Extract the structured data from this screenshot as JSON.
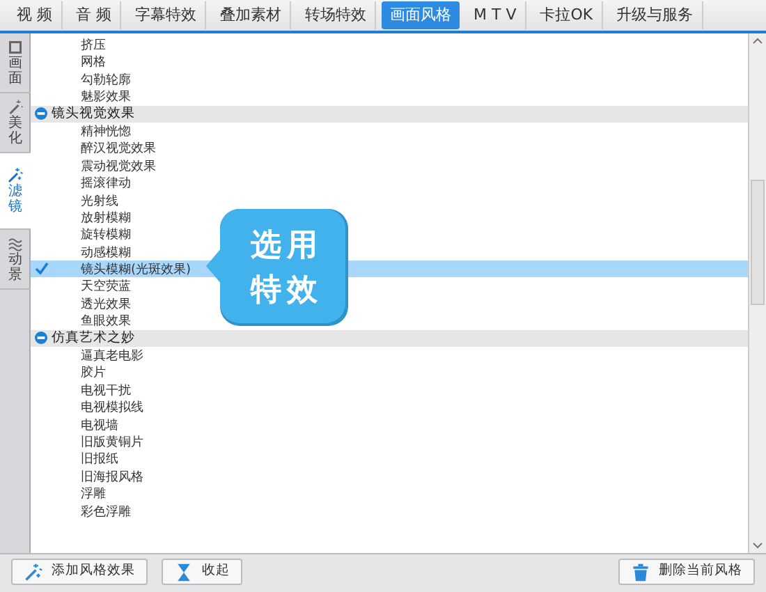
{
  "tabs": [
    {
      "label": "视 频",
      "selected": false
    },
    {
      "label": "音 频",
      "selected": false
    },
    {
      "label": "字幕特效",
      "selected": false
    },
    {
      "label": "叠加素材",
      "selected": false
    },
    {
      "label": "转场特效",
      "selected": false
    },
    {
      "label": "画面风格",
      "selected": true
    },
    {
      "label": "M T V",
      "selected": false
    },
    {
      "label": "卡拉OK",
      "selected": false
    },
    {
      "label": "升级与服务",
      "selected": false
    }
  ],
  "sidebar": {
    "items": [
      {
        "label": "画面",
        "selected": false
      },
      {
        "label": "美化",
        "selected": false
      },
      {
        "label": "滤镜",
        "selected": true
      },
      {
        "label": "动景",
        "selected": false
      }
    ]
  },
  "effects": [
    {
      "kind": "item",
      "label": "挤压",
      "selected": false
    },
    {
      "kind": "item",
      "label": "网格",
      "selected": false
    },
    {
      "kind": "item",
      "label": "勾勒轮廓",
      "selected": false
    },
    {
      "kind": "item",
      "label": "魅影效果",
      "selected": false
    },
    {
      "kind": "group",
      "label": "镜头视觉效果",
      "expanded": true
    },
    {
      "kind": "item",
      "label": "精神恍惚",
      "selected": false
    },
    {
      "kind": "item",
      "label": "醉汉视觉效果",
      "selected": false
    },
    {
      "kind": "item",
      "label": "震动视觉效果",
      "selected": false
    },
    {
      "kind": "item",
      "label": "摇滚律动",
      "selected": false
    },
    {
      "kind": "item",
      "label": "光射线",
      "selected": false
    },
    {
      "kind": "item",
      "label": "放射模糊",
      "selected": false
    },
    {
      "kind": "item",
      "label": "旋转模糊",
      "selected": false
    },
    {
      "kind": "item",
      "label": "动感模糊",
      "selected": false
    },
    {
      "kind": "item",
      "label": "镜头模糊(光斑效果)",
      "selected": true
    },
    {
      "kind": "item",
      "label": "天空荧蓝",
      "selected": false
    },
    {
      "kind": "item",
      "label": "透光效果",
      "selected": false
    },
    {
      "kind": "item",
      "label": "鱼眼效果",
      "selected": false
    },
    {
      "kind": "group",
      "label": "仿真艺术之妙",
      "expanded": true
    },
    {
      "kind": "item",
      "label": "逼真老电影",
      "selected": false
    },
    {
      "kind": "item",
      "label": "胶片",
      "selected": false
    },
    {
      "kind": "item",
      "label": "电视干扰",
      "selected": false
    },
    {
      "kind": "item",
      "label": "电视模拟线",
      "selected": false
    },
    {
      "kind": "item",
      "label": "电视墙",
      "selected": false
    },
    {
      "kind": "item",
      "label": "旧版黄铜片",
      "selected": false
    },
    {
      "kind": "item",
      "label": "旧报纸",
      "selected": false
    },
    {
      "kind": "item",
      "label": "旧海报风格",
      "selected": false
    },
    {
      "kind": "item",
      "label": "浮雕",
      "selected": false
    },
    {
      "kind": "item",
      "label": "彩色浮雕",
      "selected": false
    }
  ],
  "callout": {
    "lines": [
      "选用",
      "特效"
    ]
  },
  "buttons": [
    {
      "label": "添加风格效果"
    },
    {
      "label": "收起"
    }
  ],
  "delete_button": {
    "label": "删除当前风格"
  }
}
